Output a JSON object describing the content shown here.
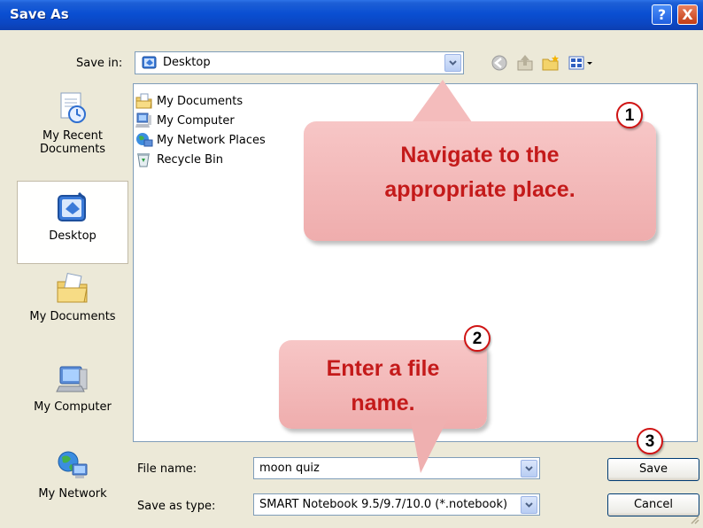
{
  "window": {
    "title": "Save As",
    "help_glyph": "?",
    "close_glyph": "X"
  },
  "savein": {
    "label": "Save in:",
    "value": "Desktop"
  },
  "toolbar": {
    "icons": [
      "back-icon",
      "up-folder-icon",
      "new-folder-icon",
      "views-menu-icon"
    ]
  },
  "places": [
    {
      "label": "My Recent Documents",
      "icon": "recent-documents-icon"
    },
    {
      "label": "Desktop",
      "icon": "desktop-icon",
      "selected": true
    },
    {
      "label": "My Documents",
      "icon": "my-documents-icon"
    },
    {
      "label": "My Computer",
      "icon": "my-computer-icon"
    },
    {
      "label": "My Network",
      "icon": "my-network-icon"
    }
  ],
  "files": [
    {
      "label": "My Documents",
      "icon": "my-documents-icon"
    },
    {
      "label": "My Computer",
      "icon": "my-computer-icon"
    },
    {
      "label": "My Network Places",
      "icon": "network-places-icon"
    },
    {
      "label": "Recycle Bin",
      "icon": "recycle-bin-icon"
    }
  ],
  "form": {
    "filename_label": "File name:",
    "filename_value": "moon quiz",
    "type_label": "Save as type:",
    "type_value": "SMART Notebook 9.5/9.7/10.0 (*.notebook)",
    "save_label": "Save",
    "cancel_label": "Cancel"
  },
  "callouts": {
    "step1": {
      "number": "1",
      "line1": "Navigate to the",
      "line2": "appropriate place."
    },
    "step2": {
      "number": "2",
      "line1": "Enter a file",
      "line2": "name."
    },
    "step3": {
      "number": "3"
    }
  },
  "colors": {
    "titlebar": "#0A4FD2",
    "callout_fill": "#F2B8B8",
    "callout_text": "#C41A1A",
    "step_ring": "#D01414"
  }
}
